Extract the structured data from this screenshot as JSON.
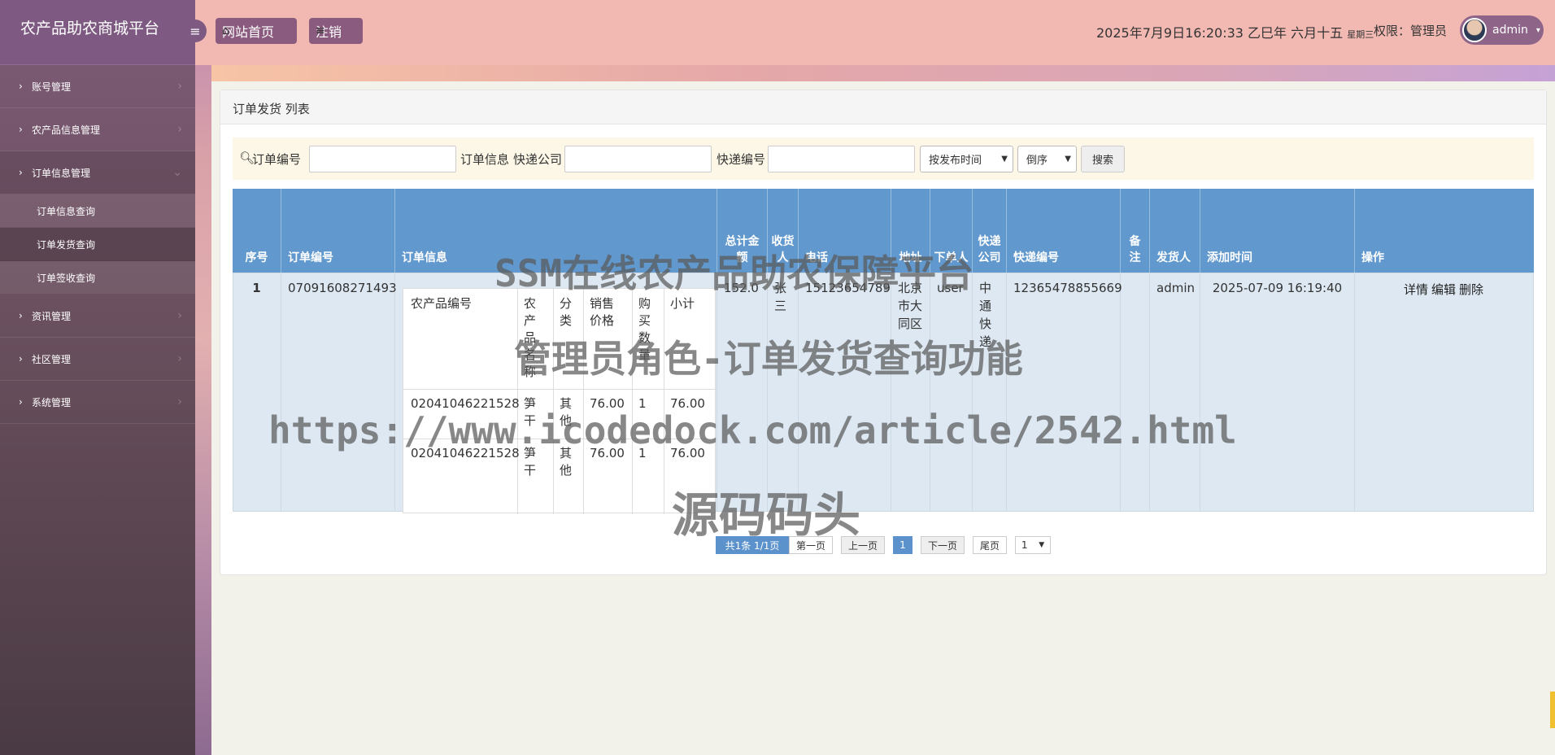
{
  "app": {
    "title": "农产品助农商城平台"
  },
  "sidebar": {
    "items": [
      {
        "label": "账号管理"
      },
      {
        "label": "农产品信息管理"
      },
      {
        "label": "订单信息管理"
      },
      {
        "label": "资讯管理"
      },
      {
        "label": "社区管理"
      },
      {
        "label": "系统管理"
      }
    ],
    "sub_items": [
      {
        "label": "订单信息查询"
      },
      {
        "label": "订单发货查询"
      },
      {
        "label": "订单签收查询"
      }
    ]
  },
  "topbar": {
    "home_label": "网站首页",
    "logout_label": "注销",
    "datetime": "2025年7月9日16:20:33 乙巳年 六月十五",
    "weekday": "星期三",
    "role_text": "权限：管理员",
    "username": "admin"
  },
  "panel": {
    "title": "订单发货 列表"
  },
  "search": {
    "label_order_no": "订单编号",
    "label_order_info": "订单信息",
    "label_courier": "快递公司",
    "label_tracking": "快递编号",
    "sort_field": "按发布时间",
    "sort_order": "倒序",
    "button_label": "搜索",
    "order_no_value": "",
    "order_info_value": "",
    "courier_value": "",
    "tracking_value": ""
  },
  "table": {
    "headers": [
      "序号",
      "订单编号",
      "订单信息",
      "总计金额",
      "收货人",
      "电话",
      "地址",
      "下单人",
      "快递公司",
      "快递编号",
      "备注",
      "发货人",
      "添加时间",
      "操作"
    ],
    "rows": [
      {
        "index": "1",
        "order_no": "07091608271493",
        "total": "152.0",
        "receiver": "张三",
        "phone": "15123654789",
        "address": "北京市大同区",
        "orderer": "user",
        "courier": "中通快递",
        "tracking_no": "12365478855669",
        "remark": "",
        "shipper": "admin",
        "added_time": "2025-07-09 16:19:40",
        "actions": [
          "详情",
          "编辑",
          "删除"
        ],
        "items_headers": [
          "农产品编号",
          "农产品名称",
          "分类",
          "销售价格",
          "购买数量",
          "小计"
        ],
        "items": [
          {
            "code": "02041046221528",
            "name": "笋干",
            "category": "其他",
            "price": "76.00",
            "qty": "1",
            "subtotal": "76.00"
          },
          {
            "code": "02041046221528",
            "name": "笋干",
            "category": "其他",
            "price": "76.00",
            "qty": "1",
            "subtotal": "76.00"
          }
        ]
      }
    ]
  },
  "pagination": {
    "summary": "共1条  1/1页",
    "first": "第一页",
    "prev": "上一页",
    "current": "1",
    "next": "下一页",
    "last": "尾页",
    "jump_value": "1"
  },
  "watermark": {
    "line1": "SSM在线农产品助农保障平台",
    "line2": "管理员角色-订单发货查询功能",
    "line3": "https://www.icodedock.com/article/2542.html",
    "line4": "源码码头"
  }
}
